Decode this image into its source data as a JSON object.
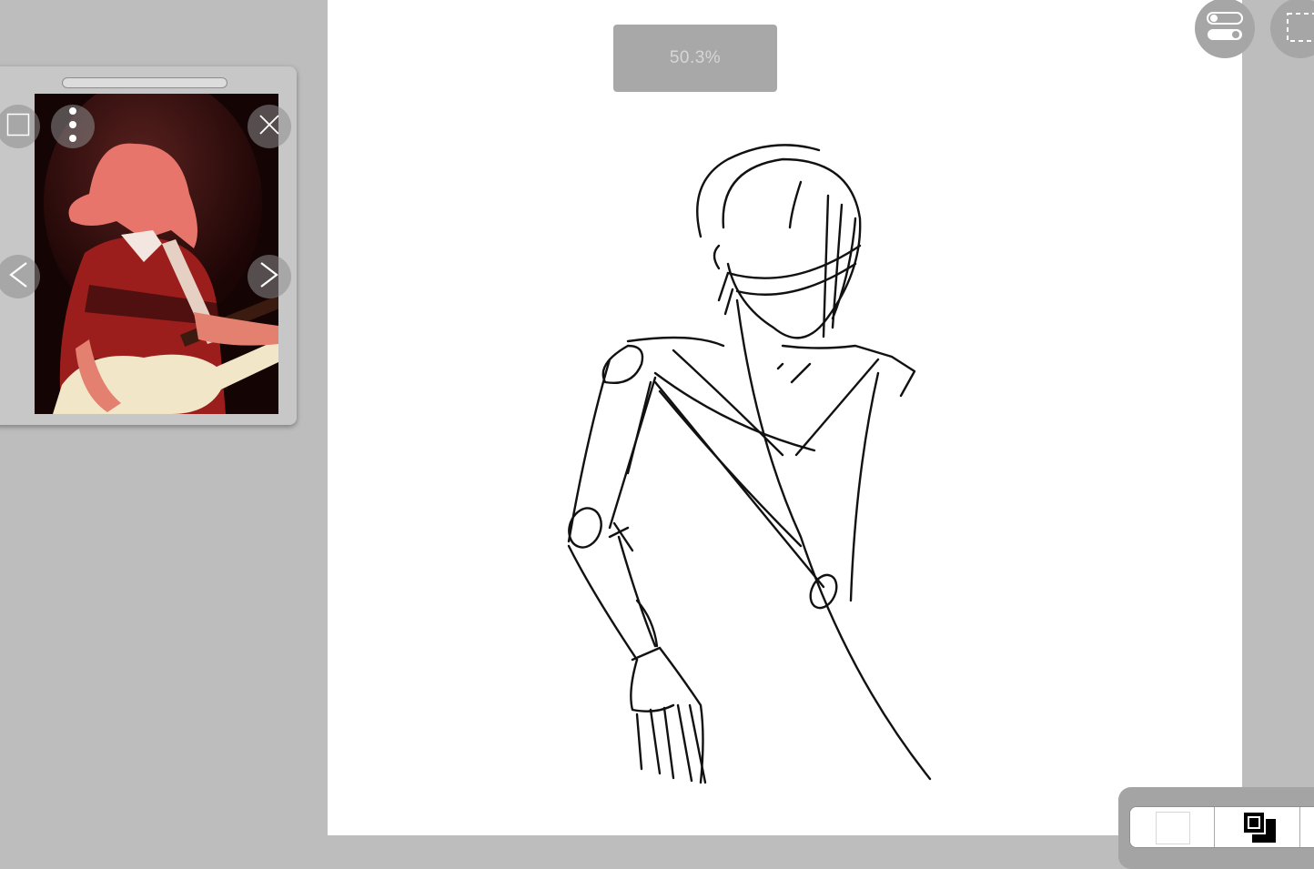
{
  "canvas": {
    "zoom_label": "50.3%"
  },
  "reference_panel": {
    "icons": {
      "expand": "square-outline-icon",
      "menu": "more-vertical-icon",
      "close": "close-icon",
      "prev": "chevron-left-icon",
      "next": "chevron-right-icon"
    }
  },
  "toolbar": {
    "icons": {
      "toggle": "toggle-settings-icon",
      "selection": "dashed-selection-icon"
    }
  },
  "layers": {
    "icons": [
      "white-layer-icon",
      "black-layer-icon"
    ]
  },
  "colors": {
    "background": "#bdbdbd",
    "canvas": "#ffffff",
    "zoom_badge": "#a8a8a8"
  }
}
